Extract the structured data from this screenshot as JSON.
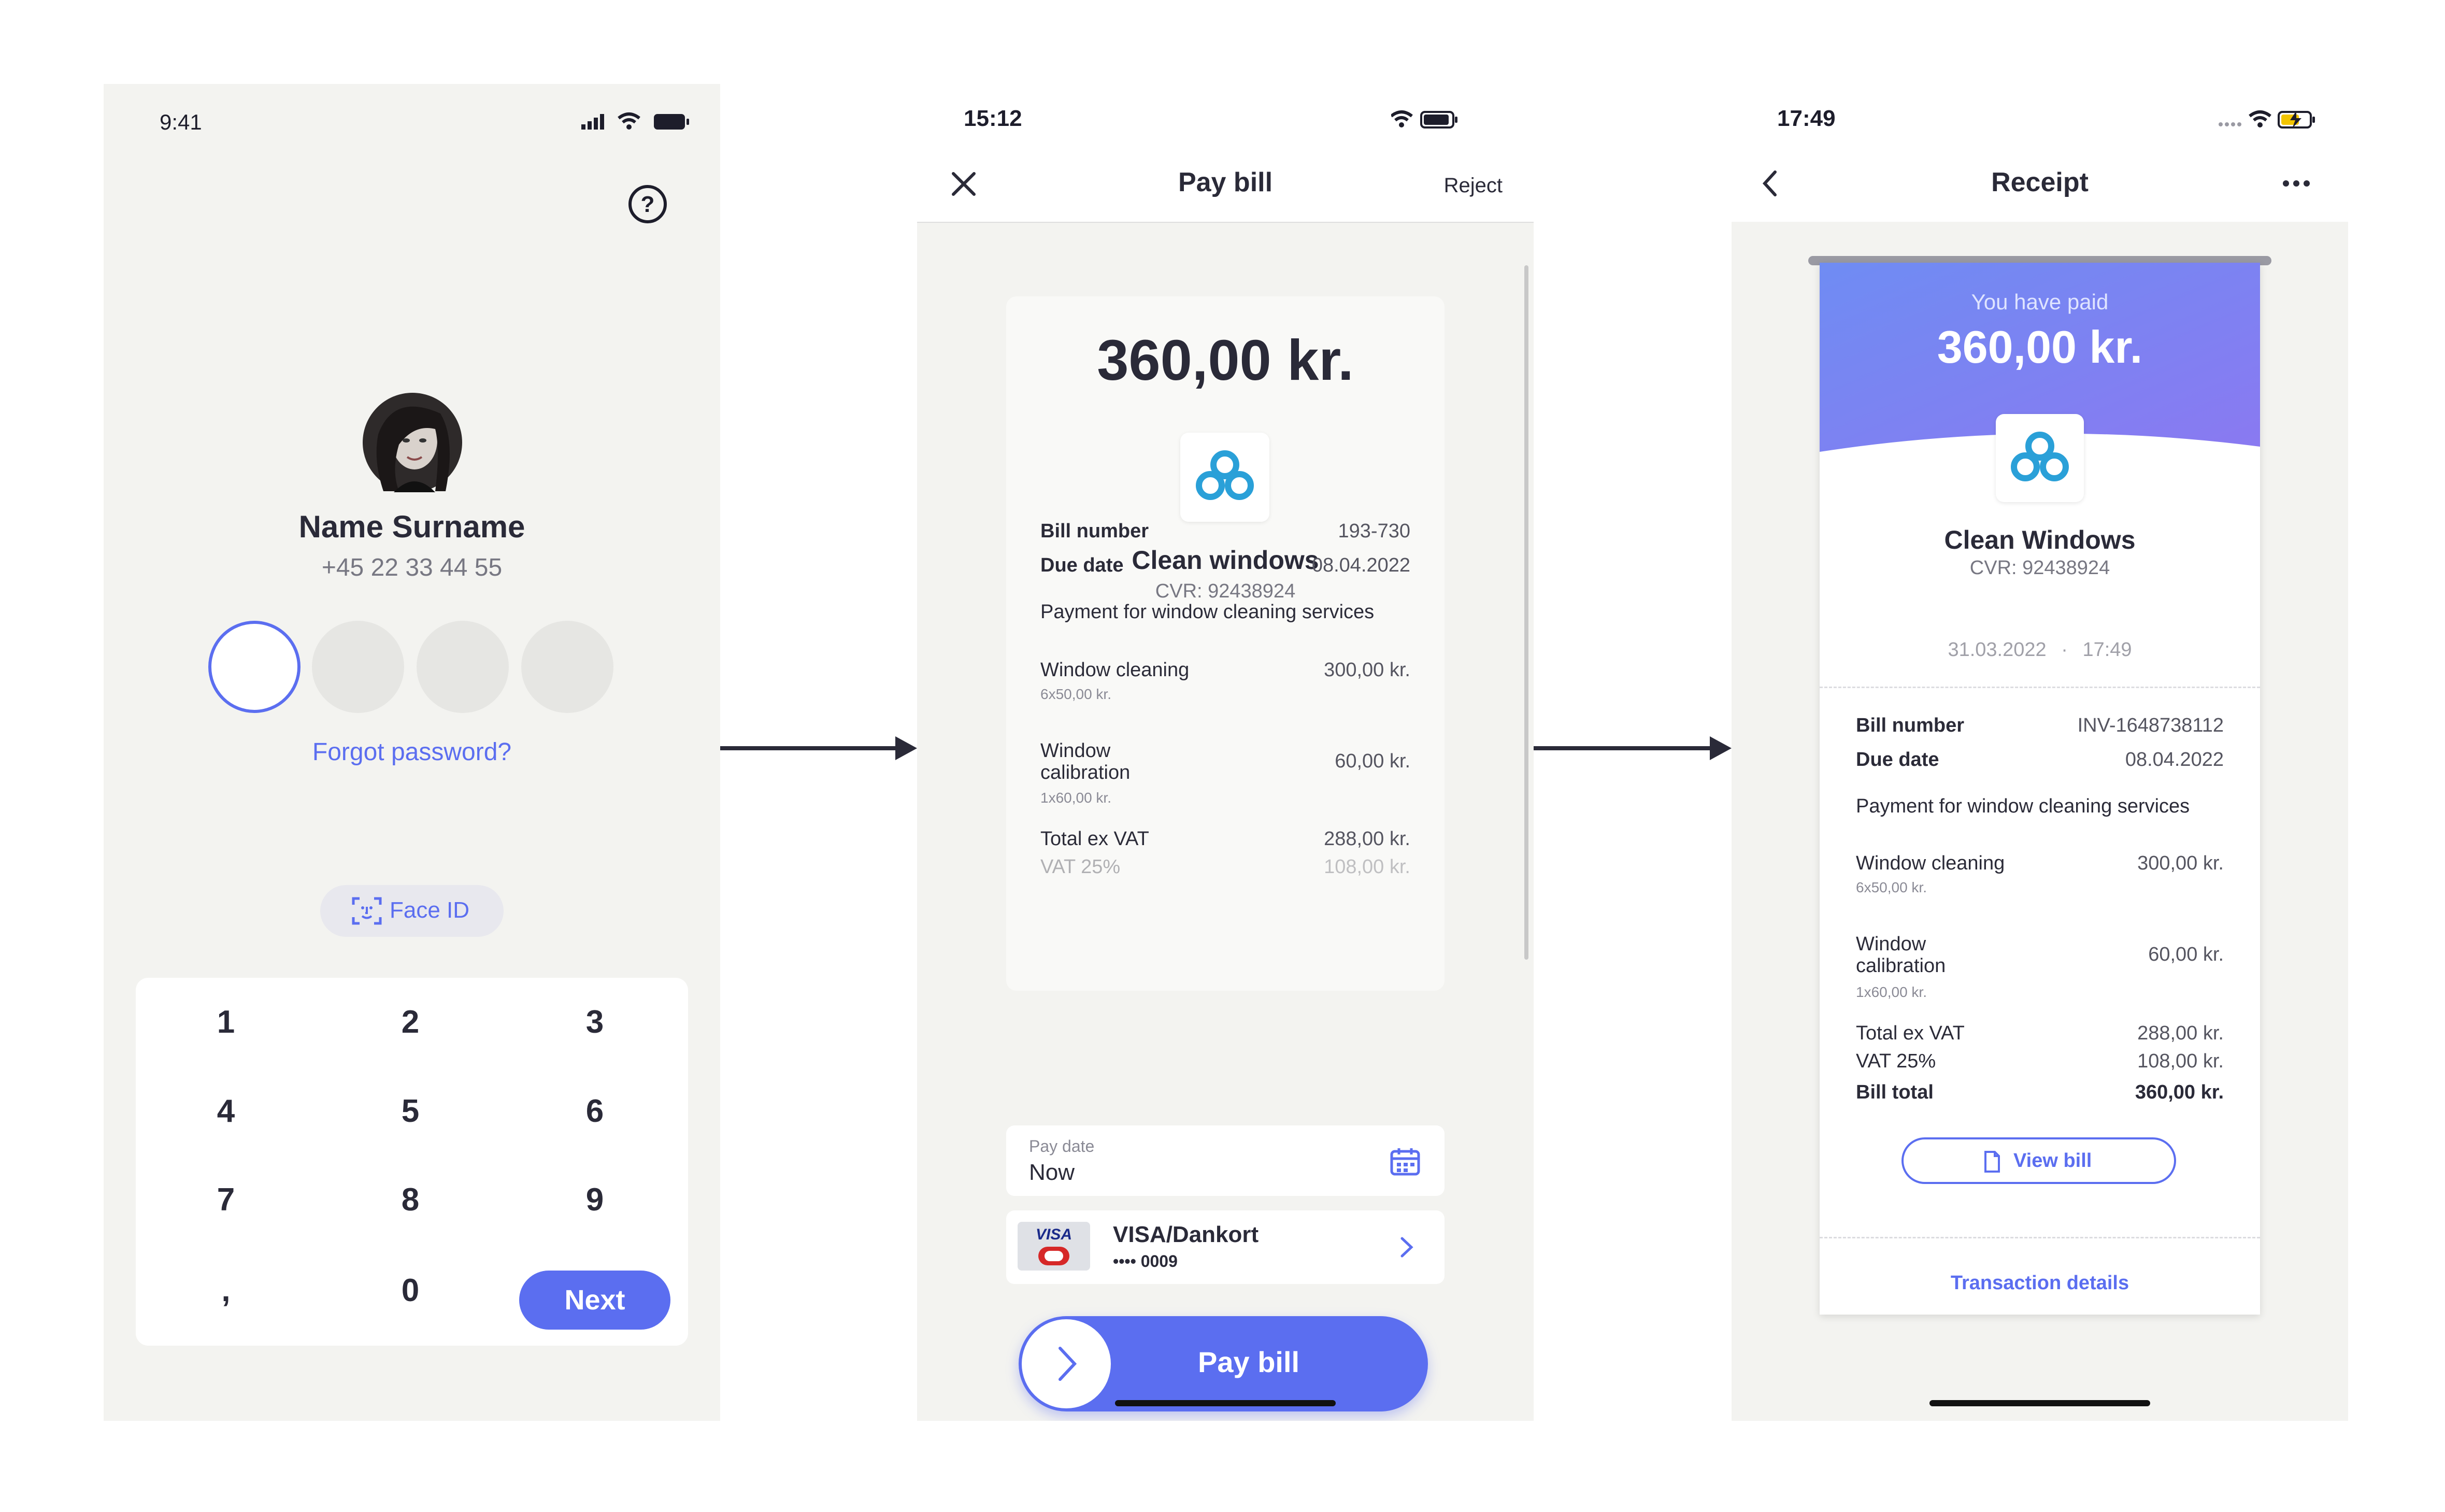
{
  "colors": {
    "accent": "#5b6ef0",
    "phone_bg": "#f3f3f0",
    "dark_text": "#2a2a38",
    "muted_text": "#8a8a95"
  },
  "login": {
    "status_time": "9:41",
    "name": "Name Surname",
    "phone": "+45 22 33 44 55",
    "forgot": "Forgot password?",
    "face_id": "Face ID",
    "keys": [
      "1",
      "2",
      "3",
      "4",
      "5",
      "6",
      "7",
      "8",
      "9",
      ",",
      "0"
    ],
    "next": "Next"
  },
  "paybill": {
    "status_time": "15:12",
    "title": "Pay bill",
    "reject": "Reject",
    "amount": "360,00 kr.",
    "merchant": "Clean windows",
    "cvr": "CVR: 92438924",
    "bill_number_label": "Bill number",
    "bill_number": "193-730",
    "due_date_label": "Due date",
    "due_date": "08.04.2022",
    "description": "Payment for window cleaning services",
    "items": [
      {
        "name": "Window cleaning",
        "sub": "6x50,00 kr.",
        "amount": "300,00 kr."
      },
      {
        "name": "Window calibration",
        "sub": "1x60,00 kr.",
        "amount": "60,00 kr."
      }
    ],
    "total_ex_vat_label": "Total ex VAT",
    "total_ex_vat": "288,00 kr.",
    "vat_label": "VAT 25%",
    "vat": "108,00 kr.",
    "pay_date_label": "Pay date",
    "pay_date": "Now",
    "card_name": "VISA/Dankort",
    "card_number": "•••• 0009",
    "card_brand": "VISA",
    "pay_button": "Pay bill"
  },
  "receipt": {
    "status_time": "17:49",
    "title": "Receipt",
    "paid_label": "You have paid",
    "amount": "360,00 kr.",
    "merchant": "Clean Windows",
    "cvr": "CVR: 92438924",
    "date": "31.03.2022",
    "time": "17:49",
    "bill_number_label": "Bill number",
    "bill_number": "INV-1648738112",
    "due_date_label": "Due date",
    "due_date": "08.04.2022",
    "description": "Payment for window cleaning services",
    "items": [
      {
        "name": "Window cleaning",
        "sub": "6x50,00 kr.",
        "amount": "300,00 kr."
      },
      {
        "name": "Window calibration",
        "sub": "1x60,00 kr.",
        "amount": "60,00 kr."
      }
    ],
    "total_ex_vat_label": "Total ex VAT",
    "total_ex_vat": "288,00 kr.",
    "vat_label": "VAT 25%",
    "vat": "108,00 kr.",
    "bill_total_label": "Bill total",
    "bill_total": "360,00 kr.",
    "view_bill": "View bill",
    "transaction_details": "Transaction details"
  }
}
